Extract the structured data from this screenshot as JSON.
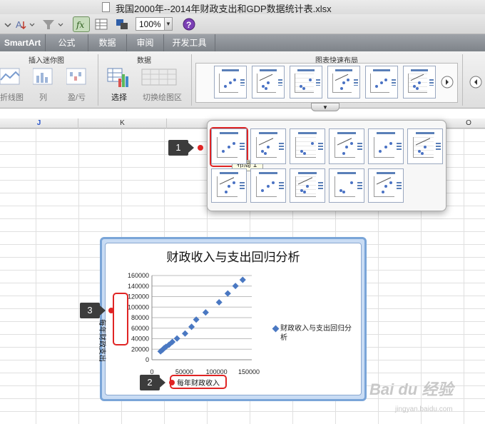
{
  "window": {
    "title": "我国2000年--2014年财政支出和GDP数据统计表.xlsx"
  },
  "toolbar": {
    "zoom": "100%",
    "fx_label": "fx"
  },
  "ribbon_tabs": [
    "SmartArt",
    "公式",
    "数据",
    "审阅",
    "开发工具"
  ],
  "ribbon": {
    "groups": {
      "sparklines": "插入迷你图",
      "data": "数据",
      "quick_layouts": "图表快速布局"
    },
    "sparkline_buttons": [
      "折线图",
      "列",
      "盈/亏"
    ],
    "data_buttons": {
      "select": "选择",
      "switch": "切换绘图区"
    }
  },
  "sheet": {
    "columns": [
      "J",
      "K",
      "O"
    ]
  },
  "gallery": {
    "tooltip": "布局 1"
  },
  "annotations": {
    "callout_1": "1",
    "callout_2": "2",
    "callout_3": "3"
  },
  "chart_data": {
    "type": "scatter",
    "title": "财政收入与支出回归分析",
    "xlabel": "每年财政收入",
    "ylabel": "每年财政支出",
    "xlim": [
      0,
      150000
    ],
    "ylim": [
      0,
      160000
    ],
    "x_ticks": [
      "0",
      "50000",
      "100000",
      "150000"
    ],
    "y_ticks": [
      "0",
      "20000",
      "40000",
      "60000",
      "80000",
      "100000",
      "120000",
      "140000",
      "160000"
    ],
    "legend_position": "right",
    "series": [
      {
        "name": "财政收入与支出回归分析",
        "color": "#4a78c2",
        "points": [
          [
            13400,
            15900
          ],
          [
            16400,
            18900
          ],
          [
            18900,
            22100
          ],
          [
            21700,
            24600
          ],
          [
            26400,
            28500
          ],
          [
            31600,
            33900
          ],
          [
            38800,
            40400
          ],
          [
            51300,
            49800
          ],
          [
            61300,
            62600
          ],
          [
            68500,
            76300
          ],
          [
            83100,
            89900
          ],
          [
            103900,
            109200
          ],
          [
            117300,
            125950
          ],
          [
            129200,
            140200
          ],
          [
            140400,
            151800
          ]
        ]
      }
    ]
  },
  "watermark": {
    "brand": "Bai du 经验",
    "url": "jingyan.baidu.com"
  }
}
